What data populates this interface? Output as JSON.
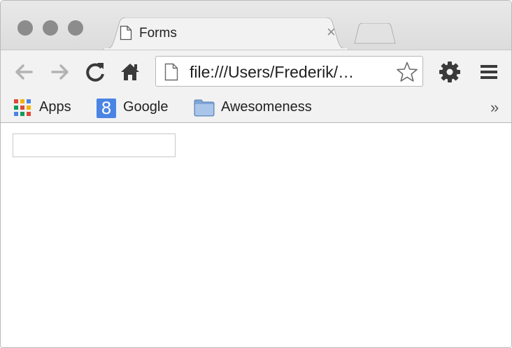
{
  "window": {
    "traffic_lights": [
      "close",
      "minimize",
      "zoom"
    ]
  },
  "tabs": [
    {
      "title": "Forms",
      "icon": "page-icon",
      "close_glyph": "×"
    }
  ],
  "toolbar": {
    "back_icon": "arrow-left-icon",
    "forward_icon": "arrow-right-icon",
    "reload_icon": "reload-icon",
    "home_icon": "home-icon",
    "address": "file:///Users/Frederik/…",
    "bookmark_icon": "star-icon",
    "settings_icon": "gear-icon",
    "menu_icon": "hamburger-icon"
  },
  "bookmarks": {
    "items": [
      {
        "label": "Apps",
        "icon": "apps-grid-icon"
      },
      {
        "label": "Google",
        "icon": "google-icon",
        "icon_glyph": "8"
      },
      {
        "label": "Awesomeness",
        "icon": "folder-icon"
      }
    ],
    "overflow_glyph": "»"
  },
  "page": {
    "input": {
      "value": "",
      "placeholder": ""
    }
  },
  "colors": {
    "tabstrip_bg": "#dcdcdc",
    "toolbar_bg": "#f2f2f2",
    "traffic_light": "#8c8c8c",
    "google_blue": "#4a84e5",
    "folder_blue": "#7fa6d6"
  }
}
